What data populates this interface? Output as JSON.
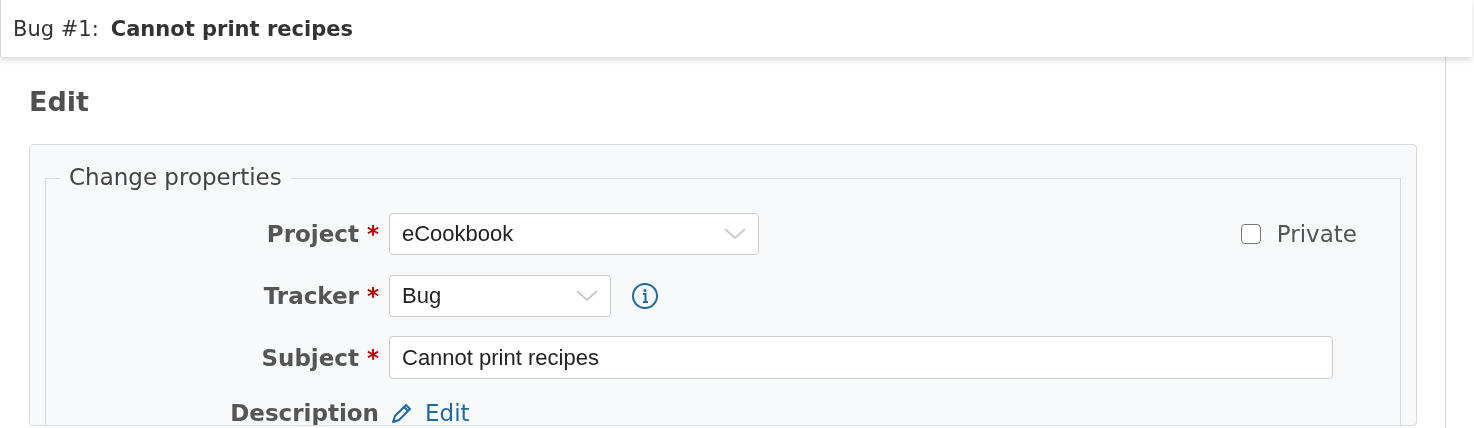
{
  "sticky_header": {
    "tracker_number": "Bug #1:",
    "subject": "Cannot print recipes"
  },
  "heading": "Edit",
  "fieldset": {
    "legend": "Change properties",
    "fields": [
      {
        "kind": "select",
        "label": "Project",
        "required": true,
        "value": "eCookbook"
      },
      {
        "kind": "select",
        "label": "Tracker",
        "required": true,
        "value": "Bug",
        "info": true
      },
      {
        "kind": "text",
        "label": "Subject",
        "required": true,
        "value": "Cannot print recipes"
      },
      {
        "kind": "link",
        "label": "Description",
        "required": false,
        "link": "Edit"
      }
    ],
    "private": {
      "label": "Private",
      "checked": false
    }
  },
  "required_mark": "*"
}
